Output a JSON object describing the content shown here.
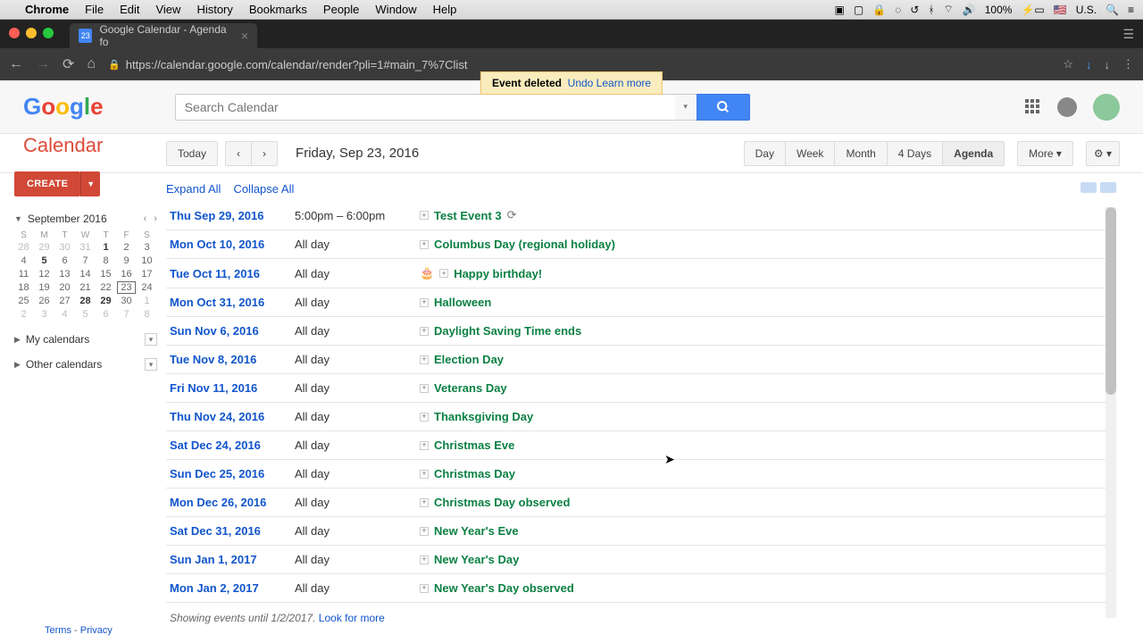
{
  "mac_menu": {
    "items": [
      "Chrome",
      "File",
      "Edit",
      "View",
      "History",
      "Bookmarks",
      "People",
      "Window",
      "Help"
    ],
    "battery": "100%",
    "locale": "U.S."
  },
  "browser": {
    "tab_title": "Google Calendar - Agenda fo",
    "favicon_text": "23",
    "url": "https://calendar.google.com/calendar/render?pli=1#main_7%7Clist"
  },
  "search": {
    "placeholder": "Search Calendar"
  },
  "alert": {
    "text": "Event deleted",
    "undo": "Undo",
    "learn": "Learn more"
  },
  "header": {
    "calendar_title": "Calendar",
    "today": "Today",
    "date": "Friday, Sep 23, 2016",
    "views": [
      "Day",
      "Week",
      "Month",
      "4 Days",
      "Agenda"
    ],
    "active_view": "Agenda",
    "more": "More"
  },
  "sidebar": {
    "create": "CREATE",
    "month_label": "September 2016",
    "dows": [
      "S",
      "M",
      "T",
      "W",
      "T",
      "F",
      "S"
    ],
    "weeks": [
      [
        {
          "d": "28",
          "o": true
        },
        {
          "d": "29",
          "o": true
        },
        {
          "d": "30",
          "o": true
        },
        {
          "d": "31",
          "o": true
        },
        {
          "d": "1",
          "b": true
        },
        {
          "d": "2"
        },
        {
          "d": "3"
        }
      ],
      [
        {
          "d": "4"
        },
        {
          "d": "5",
          "b": true
        },
        {
          "d": "6"
        },
        {
          "d": "7"
        },
        {
          "d": "8"
        },
        {
          "d": "9"
        },
        {
          "d": "10"
        }
      ],
      [
        {
          "d": "11"
        },
        {
          "d": "12"
        },
        {
          "d": "13"
        },
        {
          "d": "14"
        },
        {
          "d": "15"
        },
        {
          "d": "16"
        },
        {
          "d": "17"
        }
      ],
      [
        {
          "d": "18"
        },
        {
          "d": "19"
        },
        {
          "d": "20"
        },
        {
          "d": "21"
        },
        {
          "d": "22"
        },
        {
          "d": "23",
          "t": true
        },
        {
          "d": "24"
        }
      ],
      [
        {
          "d": "25"
        },
        {
          "d": "26"
        },
        {
          "d": "27"
        },
        {
          "d": "28",
          "b": true
        },
        {
          "d": "29",
          "b": true
        },
        {
          "d": "30"
        },
        {
          "d": "1",
          "o": true
        }
      ],
      [
        {
          "d": "2",
          "o": true
        },
        {
          "d": "3",
          "o": true
        },
        {
          "d": "4",
          "o": true
        },
        {
          "d": "5",
          "o": true
        },
        {
          "d": "6",
          "o": true
        },
        {
          "d": "7",
          "o": true
        },
        {
          "d": "8",
          "o": true
        }
      ]
    ],
    "my_calendars": "My calendars",
    "other_calendars": "Other calendars"
  },
  "agenda": {
    "expand": "Expand All",
    "collapse": "Collapse All",
    "rows": [
      {
        "date": "Thu Sep 29, 2016",
        "time": "5:00pm – 6:00pm",
        "title": "Test Event 3",
        "repeat": true
      },
      {
        "date": "Mon Oct 10, 2016",
        "time": "All day",
        "title": "Columbus Day (regional holiday)"
      },
      {
        "date": "Tue Oct 11, 2016",
        "time": "All day",
        "title": "Happy birthday!",
        "cake": true
      },
      {
        "date": "Mon Oct 31, 2016",
        "time": "All day",
        "title": "Halloween"
      },
      {
        "date": "Sun Nov 6, 2016",
        "time": "All day",
        "title": "Daylight Saving Time ends"
      },
      {
        "date": "Tue Nov 8, 2016",
        "time": "All day",
        "title": "Election Day"
      },
      {
        "date": "Fri Nov 11, 2016",
        "time": "All day",
        "title": "Veterans Day"
      },
      {
        "date": "Thu Nov 24, 2016",
        "time": "All day",
        "title": "Thanksgiving Day"
      },
      {
        "date": "Sat Dec 24, 2016",
        "time": "All day",
        "title": "Christmas Eve"
      },
      {
        "date": "Sun Dec 25, 2016",
        "time": "All day",
        "title": "Christmas Day"
      },
      {
        "date": "Mon Dec 26, 2016",
        "time": "All day",
        "title": "Christmas Day observed"
      },
      {
        "date": "Sat Dec 31, 2016",
        "time": "All day",
        "title": "New Year's Eve"
      },
      {
        "date": "Sun Jan 1, 2017",
        "time": "All day",
        "title": "New Year's Day"
      },
      {
        "date": "Mon Jan 2, 2017",
        "time": "All day",
        "title": "New Year's Day observed"
      }
    ],
    "footer_text": "Showing events until 1/2/2017.",
    "footer_link": "Look for more"
  },
  "footer": {
    "terms": "Terms",
    "privacy": "Privacy"
  }
}
